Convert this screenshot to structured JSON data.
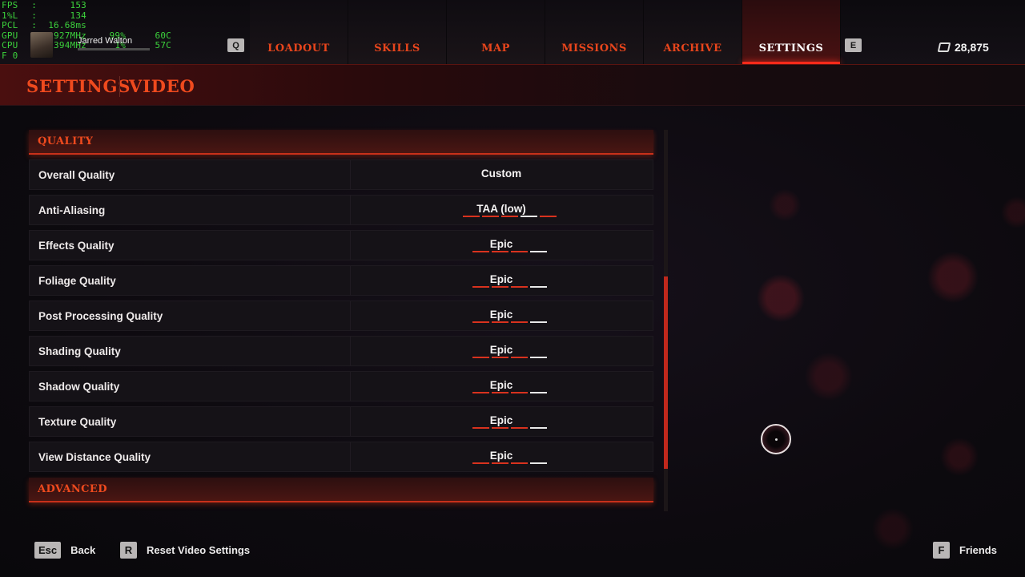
{
  "perf_overlay": {
    "rows": [
      {
        "key": "FPS",
        "sep": ":",
        "value": "153",
        "extra": "",
        "extra2": ""
      },
      {
        "key": "1%L",
        "sep": ":",
        "value": "134",
        "extra": "",
        "extra2": ""
      },
      {
        "key": "PCL",
        "sep": ":",
        "value": "16.68ms",
        "extra": "",
        "extra2": ""
      },
      {
        "key": "GPU",
        "sep": ":",
        "value": "1927MHz",
        "extra": "99%",
        "extra2": "60C"
      },
      {
        "key": "CPU",
        "sep": ":",
        "value": "5394MHz",
        "extra": "1%",
        "extra2": "57C"
      },
      {
        "key": "F 0",
        "sep": "",
        "value": "",
        "extra": "",
        "extra2": ""
      }
    ]
  },
  "player": {
    "name": "Jarred Walton"
  },
  "nav": {
    "prev_key": "Q",
    "next_key": "E",
    "tabs": [
      "LOADOUT",
      "SKILLS",
      "MAP",
      "MISSIONS",
      "ARCHIVE",
      "SETTINGS"
    ],
    "active_index": 5
  },
  "currency": {
    "amount": "28,875",
    "icon": "currency-icon"
  },
  "breadcrumb": {
    "section": "SETTINGS",
    "page": "VIDEO"
  },
  "quality_section": {
    "title": "QUALITY",
    "rows": [
      {
        "label": "Overall Quality",
        "value": "Custom",
        "ticks": 0,
        "level": 0
      },
      {
        "label": "Anti-Aliasing",
        "value": "TAA (low)",
        "ticks": 5,
        "level": 3
      },
      {
        "label": "Effects Quality",
        "value": "Epic",
        "ticks": 4,
        "level": 3
      },
      {
        "label": "Foliage Quality",
        "value": "Epic",
        "ticks": 4,
        "level": 3
      },
      {
        "label": "Post Processing Quality",
        "value": "Epic",
        "ticks": 4,
        "level": 3
      },
      {
        "label": "Shading Quality",
        "value": "Epic",
        "ticks": 4,
        "level": 3
      },
      {
        "label": "Shadow Quality",
        "value": "Epic",
        "ticks": 4,
        "level": 3
      },
      {
        "label": "Texture Quality",
        "value": "Epic",
        "ticks": 4,
        "level": 3
      },
      {
        "label": "View Distance Quality",
        "value": "Epic",
        "ticks": 4,
        "level": 3
      }
    ]
  },
  "advanced_section": {
    "title": "ADVANCED"
  },
  "footer": {
    "back_key": "Esc",
    "back_label": "Back",
    "reset_key": "R",
    "reset_label": "Reset Video Settings",
    "friends_key": "F",
    "friends_label": "Friends"
  },
  "colors": {
    "accent": "#ef4a1e",
    "tick_active": "#d8321e",
    "tick_inactive": "#e8e8e8"
  }
}
